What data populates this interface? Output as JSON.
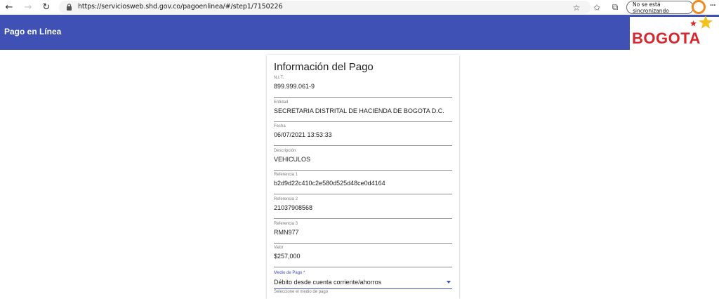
{
  "browser": {
    "url": "https://serviciosweb.shd.gov.co/pagoenlinea/#/step1/7150226",
    "sync_label": "No se está sincronizando",
    "back_glyph": "←",
    "forward_glyph": "→",
    "reload_glyph": "↻",
    "favorite_glyph": "☆",
    "favorites_glyph": "✩",
    "collections_glyph": "⧉",
    "more_glyph": "···"
  },
  "header": {
    "title": "Pago en Línea",
    "logo_text": "BOGOTA",
    "accent_color": "#3f51b5",
    "logo_color": "#d7262c"
  },
  "card": {
    "title": "Información del Pago",
    "fields": [
      {
        "label": "N.I.T.",
        "value": "899.999.061-9"
      },
      {
        "label": "Entidad",
        "value": "SECRETARIA DISTRITAL DE HACIENDA DE BOGOTA D.C."
      },
      {
        "label": "Fecha",
        "value": "06/07/2021 13:53:33"
      },
      {
        "label": "Descripción",
        "value": "VEHICULOS"
      },
      {
        "label": "Referencia 1",
        "value": "b2d9d22c410c2e580d525d48ce0d4164"
      },
      {
        "label": "Referencia 2",
        "value": "21037908568"
      },
      {
        "label": "Referencia 3",
        "value": "RMN977"
      },
      {
        "label": "Valor",
        "value": "$257,000"
      }
    ],
    "payment_method": {
      "label": "Medio de Pago *",
      "value": "Débito desde cuenta corriente/ahorros",
      "hint": "Seleccione el medio de pago"
    }
  }
}
